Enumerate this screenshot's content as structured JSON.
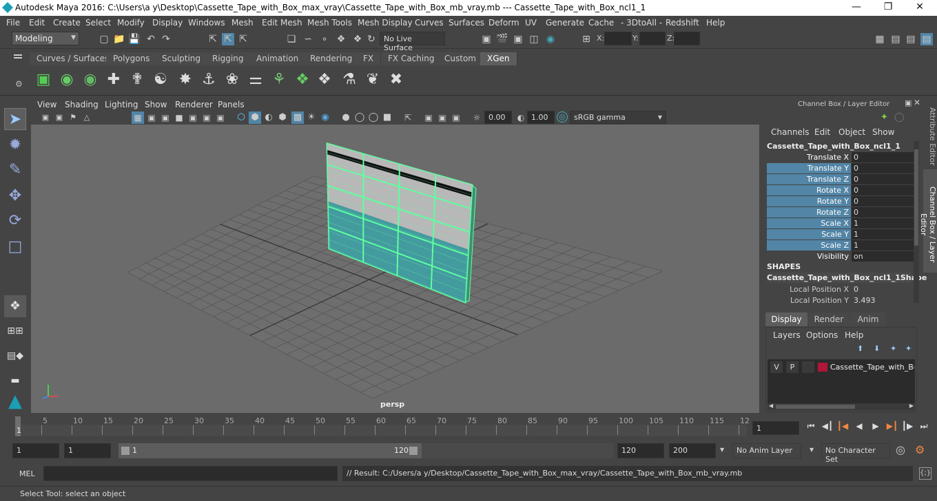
{
  "window": {
    "title": "Autodesk Maya 2016: C:\\Users\\a y\\Desktop\\Cassette_Tape_with_Box_max_vray\\Cassette_Tape_with_Box_mb_vray.mb   ---   Cassette_Tape_with_Box_ncl1_1"
  },
  "menus": [
    "File",
    "Edit",
    "Create",
    "Select",
    "Modify",
    "Display",
    "Windows",
    "Mesh",
    "Edit Mesh",
    "Mesh Tools",
    "Mesh Display",
    "Curves",
    "Surfaces",
    "Deform",
    "UV",
    "Generate",
    "Cache",
    "- 3DtoAll -",
    "Redshift",
    "Help"
  ],
  "status": {
    "mode": "Modeling",
    "live_surface": "No Live Surface",
    "x_label": "X:",
    "y_label": "Y:",
    "z_label": "Z:"
  },
  "shelf_tabs": [
    "Curves / Surfaces",
    "Polygons",
    "Sculpting",
    "Rigging",
    "Animation",
    "Rendering",
    "FX",
    "FX Caching",
    "Custom",
    "XGen"
  ],
  "shelf_active": "XGen",
  "viewport": {
    "menus": [
      "View",
      "Shading",
      "Lighting",
      "Show",
      "Renderer",
      "Panels"
    ],
    "exposure": "0.00",
    "gamma": "1.00",
    "color_space": "sRGB gamma",
    "camera": "persp"
  },
  "channel_box": {
    "header": "Channel Box / Layer Editor",
    "menus": [
      "Channels",
      "Edit",
      "Object",
      "Show"
    ],
    "object": "Cassette_Tape_with_Box_ncl1_1",
    "channels": [
      {
        "name": "Translate X",
        "value": "0",
        "hl": false
      },
      {
        "name": "Translate Y",
        "value": "0",
        "hl": true
      },
      {
        "name": "Translate Z",
        "value": "0",
        "hl": true
      },
      {
        "name": "Rotate X",
        "value": "0",
        "hl": true
      },
      {
        "name": "Rotate Y",
        "value": "0",
        "hl": true
      },
      {
        "name": "Rotate Z",
        "value": "0",
        "hl": true
      },
      {
        "name": "Scale X",
        "value": "1",
        "hl": true
      },
      {
        "name": "Scale Y",
        "value": "1",
        "hl": true
      },
      {
        "name": "Scale Z",
        "value": "1",
        "hl": true
      },
      {
        "name": "Visibility",
        "value": "on",
        "hl": false
      }
    ],
    "shapes_label": "SHAPES",
    "shape_name": "Cassette_Tape_with_Box_ncl1_1Shape",
    "shape_channels": [
      {
        "name": "Local Position X",
        "value": "0"
      },
      {
        "name": "Local Position Y",
        "value": "3.493"
      }
    ]
  },
  "side_tabs": {
    "attribute_editor": "Attribute Editor",
    "channel_box": "Channel Box / Layer Editor"
  },
  "layer_editor": {
    "tabs": [
      "Display",
      "Render",
      "Anim"
    ],
    "menus": [
      "Layers",
      "Options",
      "Help"
    ],
    "layer": {
      "v": "V",
      "p": "P",
      "name": "Cassette_Tape_with_Box",
      "color": "#b0163a"
    }
  },
  "timeline": {
    "ticks": [
      "5",
      "10",
      "15",
      "20",
      "25",
      "30",
      "35",
      "40",
      "45",
      "50",
      "55",
      "60",
      "65",
      "70",
      "75",
      "80",
      "85",
      "90",
      "95",
      "100",
      "105",
      "110",
      "115",
      "12"
    ],
    "first_frame_label": "1",
    "current_frame": "1"
  },
  "range": {
    "start": "1",
    "anim_start": "1",
    "slider_start": "1",
    "slider_end": "120",
    "end": "120",
    "anim_end": "200",
    "anim_layer": "No Anim Layer",
    "char_set": "No Character Set"
  },
  "command": {
    "label": "MEL",
    "result": "// Result: C:/Users/a y/Desktop/Cassette_Tape_with_Box_max_vray/Cassette_Tape_with_Box_mb_vray.mb"
  },
  "help": "Select Tool: select an object"
}
